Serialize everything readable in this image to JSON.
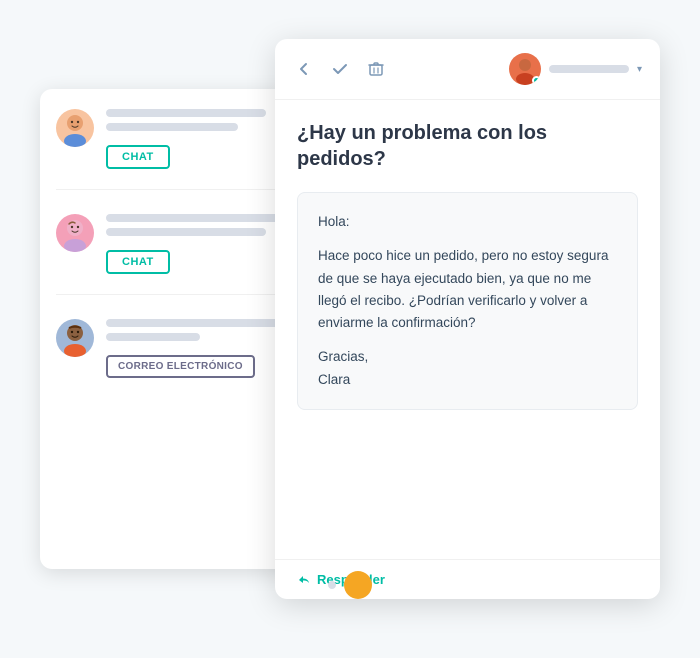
{
  "scene": {
    "bg_blob_color": "#ddeef5"
  },
  "inbox": {
    "items": [
      {
        "id": "item-1",
        "avatar_color": "#f8c4a0",
        "button_label": "CHAT",
        "button_type": "chat"
      },
      {
        "id": "item-2",
        "avatar_color": "#f4a0b8",
        "button_label": "CHAT",
        "button_type": "chat"
      },
      {
        "id": "item-3",
        "avatar_color": "#a0b8d8",
        "button_label": "CORREO ELECTRÓNICO",
        "button_type": "email"
      }
    ]
  },
  "detail": {
    "header": {
      "back_icon": "←",
      "check_icon": "✓",
      "trash_icon": "🗑",
      "avatar_color": "#e8704a",
      "status_color": "#00bda5",
      "name_placeholder": ""
    },
    "subject": "¿Hay un problema con los pedidos?",
    "message": {
      "greeting": "Hola:",
      "body": "Hace poco hice un pedido, pero no estoy segura de que se haya ejecutado bien, ya que no me llegó el recibo. ¿Podrían verificarlo y volver a enviarme la confirmación?",
      "closing": "Gracias,",
      "signature": "Clara"
    },
    "reply_button": "Responder",
    "reply_icon": "←"
  },
  "dots": {
    "small_color": "#d8dde6",
    "large_color": "#f5a623"
  }
}
